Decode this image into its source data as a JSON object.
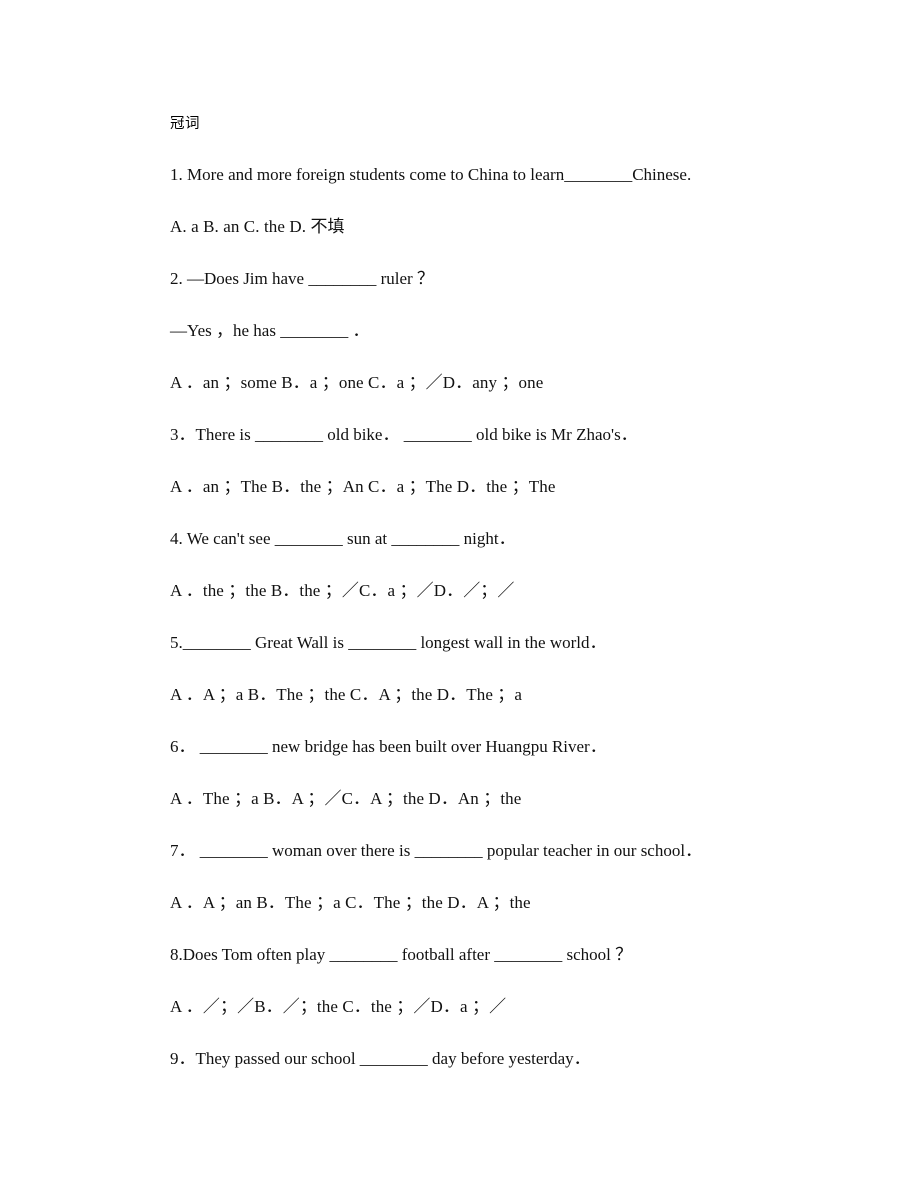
{
  "document": {
    "title": "冠词",
    "lines": [
      {
        "id": "q1-stem",
        "kind": "question",
        "text": "1. More and more foreign students come to China to learn________Chinese."
      },
      {
        "id": "q1-options",
        "kind": "options",
        "text": "A. a B. an C. the D. 不填"
      },
      {
        "id": "q2-stem",
        "kind": "question",
        "text": "2. —Does Jim have ________ ruler ？"
      },
      {
        "id": "q2-answer",
        "kind": "question",
        "text": "—Yes ，he has ________ ．"
      },
      {
        "id": "q2-options",
        "kind": "options",
        "text": "A ．an ；some B．a ；one C．a ；／D．any ；one"
      },
      {
        "id": "q3-stem",
        "kind": "question",
        "text": "3．There is ________ old bike． ________ old bike is Mr Zhao's．"
      },
      {
        "id": "q3-options",
        "kind": "options",
        "text": "A ．an ；The B．the ；An C．a ；The D．the ；The"
      },
      {
        "id": "q4-stem",
        "kind": "question",
        "text": "4. We can't see ________ sun at ________ night．"
      },
      {
        "id": "q4-options",
        "kind": "options",
        "text": "A ．the ；the B．the ；／C．a ；／D．／；／"
      },
      {
        "id": "q5-stem",
        "kind": "question",
        "text": "5.________ Great Wall is ________ longest wall in the world．"
      },
      {
        "id": "q5-options",
        "kind": "options",
        "text": "A ．A ；a B．The ；the C．A ；the D．The ；a"
      },
      {
        "id": "q6-stem",
        "kind": "question",
        "text": "6． ________ new bridge has been built over Huangpu River．"
      },
      {
        "id": "q6-options",
        "kind": "options",
        "text": "A ．The ；a B．A ；／C．A ；the D．An ；the"
      },
      {
        "id": "q7-stem",
        "kind": "question",
        "text": "7． ________ woman over there is ________ popular teacher in our school．"
      },
      {
        "id": "q7-options",
        "kind": "options",
        "text": "A ．A ；an B．The ；a C．The ；the D．A ；the"
      },
      {
        "id": "q8-stem",
        "kind": "question",
        "text": "8.Does Tom often play ________ football after ________ school ？"
      },
      {
        "id": "q8-options",
        "kind": "options",
        "text": "A ．／；／B．／；the C．the ；／D．a ；／"
      },
      {
        "id": "q9-stem",
        "kind": "question",
        "text": "9．They passed our school ________ day before yesterday．"
      }
    ]
  }
}
